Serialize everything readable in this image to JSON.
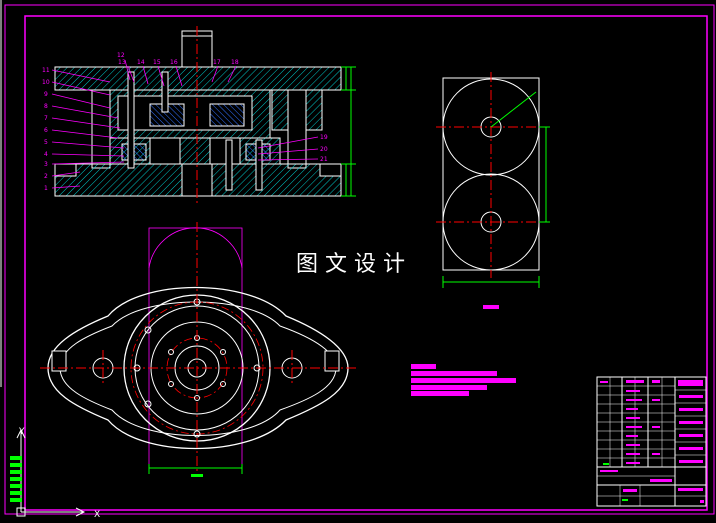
{
  "drawing": {
    "watermark_title": "图文设计",
    "part_numbers_left": [
      "11",
      "10",
      "9",
      "8",
      "7",
      "6",
      "5",
      "4",
      "3",
      "2",
      "1"
    ],
    "part_numbers_top": [
      "12",
      "13",
      "14",
      "15",
      "16",
      "17",
      "18"
    ],
    "part_numbers_right": [
      "19",
      "20",
      "21"
    ],
    "ucs_axis_x": "X",
    "ucs_axis_y": "Y"
  },
  "colors": {
    "background": "#000000",
    "outline": "#ffffff",
    "centerline": "#ff0000",
    "annotation": "#ff00ff",
    "dimension": "#00ff00",
    "hatch": "#00ffff",
    "border": "#ff00ff"
  },
  "icons": {
    "ucs": "ucs-axis-icon"
  }
}
